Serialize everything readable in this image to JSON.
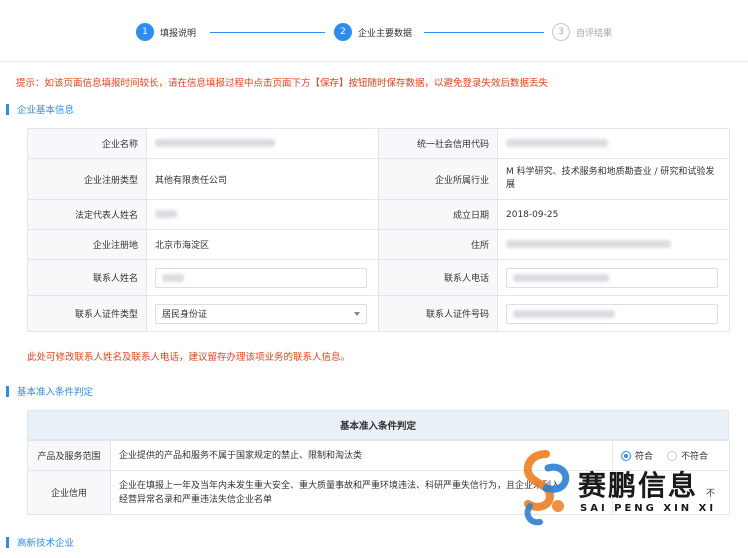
{
  "stepper": {
    "steps": [
      {
        "num": "1",
        "label": "填报说明",
        "state": "done"
      },
      {
        "num": "2",
        "label": "企业主要数据",
        "state": "active"
      },
      {
        "num": "3",
        "label": "自评结果",
        "state": "todo"
      }
    ]
  },
  "notice": "提示：如该页面信息填报时间较长，请在信息填报过程中点击页面下方【保存】按钮随时保存数据，以避免登录失效后数据丢失",
  "sections": {
    "basic_info": "企业基本信息",
    "admission": "基本准入条件判定",
    "hightech": "高新技术企业"
  },
  "basic_info": {
    "company_name_label": "企业名称",
    "credit_code_label": "统一社会信用代码",
    "reg_type_label": "企业注册类型",
    "reg_type_value": "其他有限责任公司",
    "industry_label": "企业所属行业",
    "industry_value": "M 科学研究、技术服务和地质勘查业 / 研究和试验发展",
    "legal_rep_label": "法定代表人姓名",
    "established_label": "成立日期",
    "established_value": "2018-09-25",
    "reg_place_label": "企业注册地",
    "reg_place_value": "北京市海淀区",
    "address_label": "住所",
    "contact_name_label": "联系人姓名",
    "contact_phone_label": "联系人电话",
    "contact_id_type_label": "联系人证件类型",
    "contact_id_type_value": "居民身份证",
    "contact_id_no_label": "联系人证件号码"
  },
  "contact_hint": "此处可修改联系人姓名及联系人电话，建议留存办理该项业务的联系人信息。",
  "admission": {
    "header": "基本准入条件判定",
    "rows": [
      {
        "label": "产品及服务范围",
        "text": "企业提供的产品和服务不属于国家规定的禁止、限制和淘汰类",
        "options": [
          "符合",
          "不符合"
        ],
        "selected": "符合"
      },
      {
        "label": "企业信用",
        "text_line1": "企业在填报上一年及当年内未发生重大安全、重大质量事故和严重环境违法、科研严重失信行为，且企业未列入",
        "text_line2": "经营异常名录和严重违法失信企业名单",
        "option_visible": "不"
      }
    ]
  },
  "watermark": {
    "cn": "赛鹏信息",
    "en": "SAI PENG XIN XI",
    "colors": {
      "orange": "#f07d1f",
      "blue": "#2a7fd4"
    }
  },
  "accent_color": "#2d8cf0",
  "alert_color": "#ed3f14"
}
